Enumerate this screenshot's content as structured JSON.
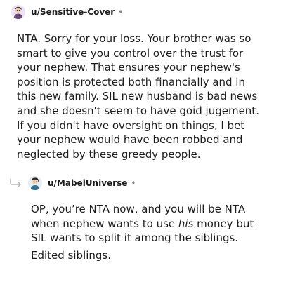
{
  "comment": {
    "username": "u/Sensitive-Cover",
    "separator": "•",
    "body": "NTA. Sorry for your loss. Your brother was so smart to give you control over the trust for your nephew. That ensures your nephew's position is protected both financially and in this new family. SIL new husband is bad news and she doesn't seem to have goid jugement. If you didn't have oversight on things, I bet your nephew would have been robbed and neglected by these greedy people."
  },
  "reply": {
    "username": "u/MabelUniverse",
    "separator": "•",
    "body_before_em": "OP, you’re NTA now, and you will be NTA when nephew wants to use ",
    "body_em": "his",
    "body_after_em": " money but SIL wants to split it among the siblings.",
    "edit_note": "Edited siblings."
  },
  "icons": {
    "reply_arrow": "reply-arrow-icon",
    "avatar": "avatar-icon"
  }
}
